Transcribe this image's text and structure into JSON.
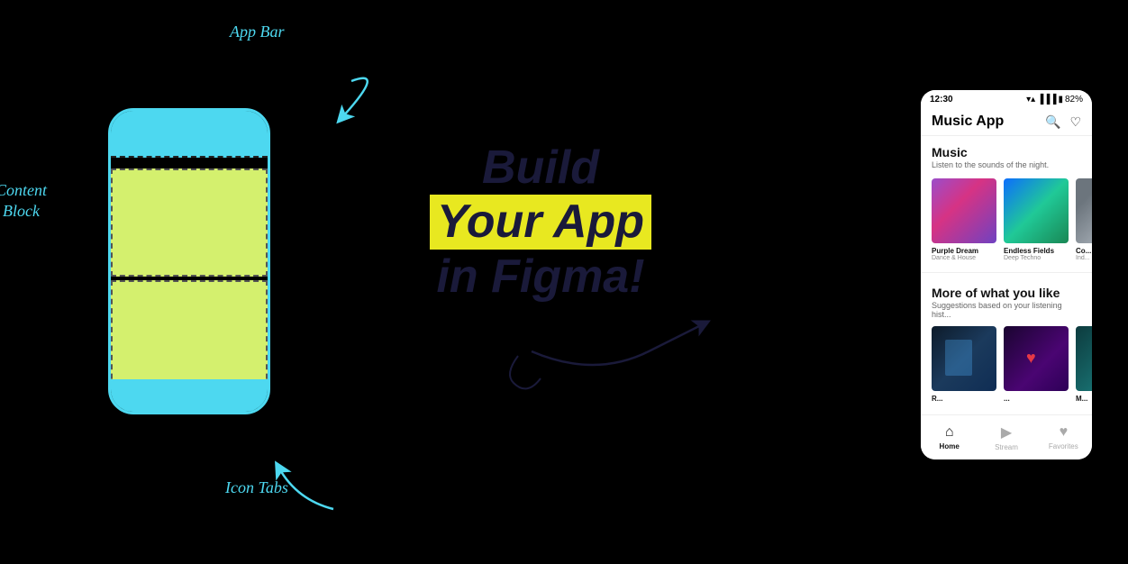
{
  "labels": {
    "app_bar": "App Bar",
    "content_block": "Content\nBlock",
    "icon_tabs": "Icon Tabs",
    "build": "Build",
    "your_app": "Your App",
    "in_figma": "in Figma!"
  },
  "mockup": {
    "status": {
      "time": "12:30",
      "battery": "82%"
    },
    "app_bar": {
      "title": "Music App"
    },
    "sections": [
      {
        "title": "Music",
        "subtitle": "Listen to the sounds of the night.",
        "albums": [
          {
            "name": "Purple Dream",
            "genre": "Dance & House",
            "art_class": "art-purple-dream"
          },
          {
            "name": "Endless Fields",
            "genre": "Deep Techno",
            "art_class": "art-endless-fields"
          },
          {
            "name": "Co...",
            "genre": "Ind...",
            "art_class": "art-co"
          }
        ]
      },
      {
        "title": "More of what you like",
        "subtitle": "Suggestions based on your listening hist...",
        "albums": [
          {
            "name": "R...",
            "genre": "",
            "art_class": "more-art-1"
          },
          {
            "name": "...",
            "genre": "",
            "art_class": "more-art-2"
          },
          {
            "name": "M...",
            "genre": "",
            "art_class": "more-art-3"
          }
        ]
      }
    ],
    "nav": [
      {
        "icon": "⌂",
        "label": "Home",
        "active": true
      },
      {
        "icon": "▶",
        "label": "Stream",
        "active": false
      },
      {
        "icon": "♥",
        "label": "Favorites",
        "active": false
      }
    ]
  }
}
